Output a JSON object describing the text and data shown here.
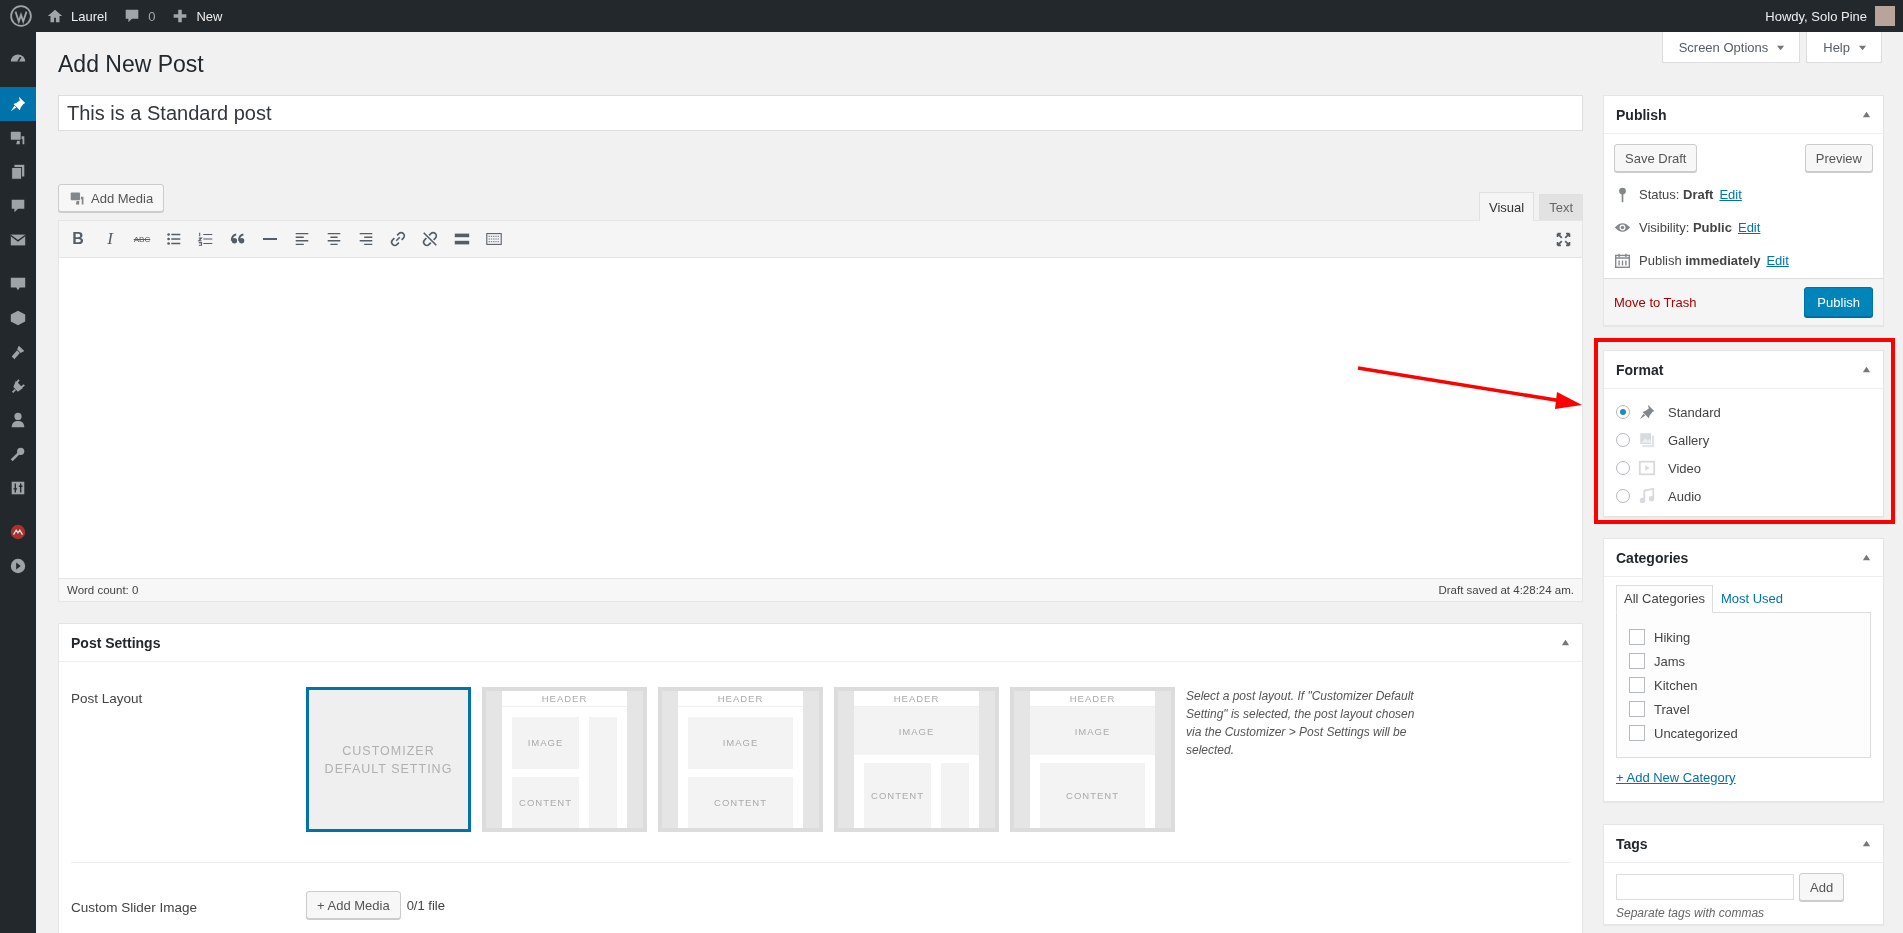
{
  "admin_bar": {
    "site_name": "Laurel",
    "comments_count": "0",
    "new_label": "New",
    "greeting": "Howdy, Solo Pine"
  },
  "sidebar_menu": [
    {
      "kind": "dashboard",
      "selected": false
    },
    {
      "kind": "pin",
      "selected": true
    },
    {
      "kind": "media",
      "selected": false
    },
    {
      "kind": "pages",
      "selected": false
    },
    {
      "kind": "comments",
      "selected": false
    },
    {
      "kind": "mail",
      "selected": false
    },
    {
      "kind": "bubble",
      "selected": false
    },
    {
      "kind": "box",
      "selected": false
    },
    {
      "kind": "brush",
      "selected": false
    },
    {
      "kind": "plug",
      "selected": false
    },
    {
      "kind": "user",
      "selected": false
    },
    {
      "kind": "wrench",
      "selected": false
    },
    {
      "kind": "sliders",
      "selected": false
    },
    {
      "kind": "badge",
      "selected": false
    },
    {
      "kind": "play",
      "selected": false
    }
  ],
  "screen_options": "Screen Options",
  "help": "Help",
  "page_title": "Add New Post",
  "post_title": "This is a Standard post",
  "editor": {
    "add_media": "Add Media",
    "tabs": [
      {
        "label": "Visual",
        "selected": true
      },
      {
        "label": "Text",
        "selected": false
      }
    ],
    "toolbar": [
      {
        "kind": "bold",
        "glyph": "B"
      },
      {
        "kind": "italic",
        "glyph": "I"
      },
      {
        "kind": "strike",
        "glyph": "ABC"
      },
      {
        "kind": "bullets"
      },
      {
        "kind": "numbers"
      },
      {
        "kind": "quote"
      },
      {
        "kind": "hr"
      },
      {
        "kind": "align-left"
      },
      {
        "kind": "align-center"
      },
      {
        "kind": "align-right"
      },
      {
        "kind": "link"
      },
      {
        "kind": "unlink"
      },
      {
        "kind": "more"
      },
      {
        "kind": "keyboard"
      }
    ],
    "word_count": "Word count: 0",
    "draft_saved": "Draft saved at 4:28:24 am."
  },
  "post_settings": {
    "title": "Post Settings",
    "layout_label": "Post Layout",
    "layouts": [
      {
        "kind": "default",
        "label": "CUSTOMIZER DEFAULT SETTING",
        "selected": true
      },
      {
        "kind": "right-sidebar",
        "header": "HEADER",
        "image": "IMAGE",
        "content": "CONTENT",
        "selected": false
      },
      {
        "kind": "no-sidebar",
        "header": "HEADER",
        "image": "IMAGE",
        "content": "CONTENT",
        "selected": false
      },
      {
        "kind": "wide-image-sidebar",
        "header": "HEADER",
        "image": "IMAGE",
        "content": "CONTENT",
        "selected": false
      },
      {
        "kind": "wide-image",
        "header": "HEADER",
        "image": "IMAGE",
        "content": "CONTENT",
        "selected": false
      }
    ],
    "layout_help": "Select a post layout. If \"Customizer Default Setting\" is selected, the post layout chosen via the Customizer > Post Settings will be selected.",
    "slider_label": "Custom Slider Image",
    "add_media": "+ Add Media",
    "file_count": "0/1 file"
  },
  "publish": {
    "title": "Publish",
    "save_draft": "Save Draft",
    "preview": "Preview",
    "rows": [
      {
        "kind": "status",
        "text": "Status: **Draft**",
        "edit": "Edit"
      },
      {
        "kind": "visibility",
        "text": "Visibility: **Public**",
        "edit": "Edit"
      },
      {
        "kind": "schedule",
        "text": "Publish **immediately**",
        "edit": "Edit"
      }
    ],
    "trash": "Move to Trash",
    "publish_button": "Publish"
  },
  "format": {
    "title": "Format",
    "options": [
      {
        "kind": "standard",
        "label": "Standard",
        "selected": true
      },
      {
        "kind": "gallery",
        "label": "Gallery",
        "selected": false
      },
      {
        "kind": "video",
        "label": "Video",
        "selected": false
      },
      {
        "kind": "audio",
        "label": "Audio",
        "selected": false
      }
    ]
  },
  "categories": {
    "title": "Categories",
    "tabs": [
      {
        "label": "All Categories",
        "selected": true
      },
      {
        "label": "Most Used",
        "selected": false
      }
    ],
    "items": [
      {
        "label": "Hiking",
        "checked": false
      },
      {
        "label": "Jams",
        "checked": false
      },
      {
        "label": "Kitchen",
        "checked": false
      },
      {
        "label": "Travel",
        "checked": false
      },
      {
        "label": "Uncategorized",
        "checked": false
      }
    ],
    "add_new": "+ Add New Category"
  },
  "tags": {
    "title": "Tags",
    "add": "Add",
    "hint": "Separate tags with commas"
  }
}
